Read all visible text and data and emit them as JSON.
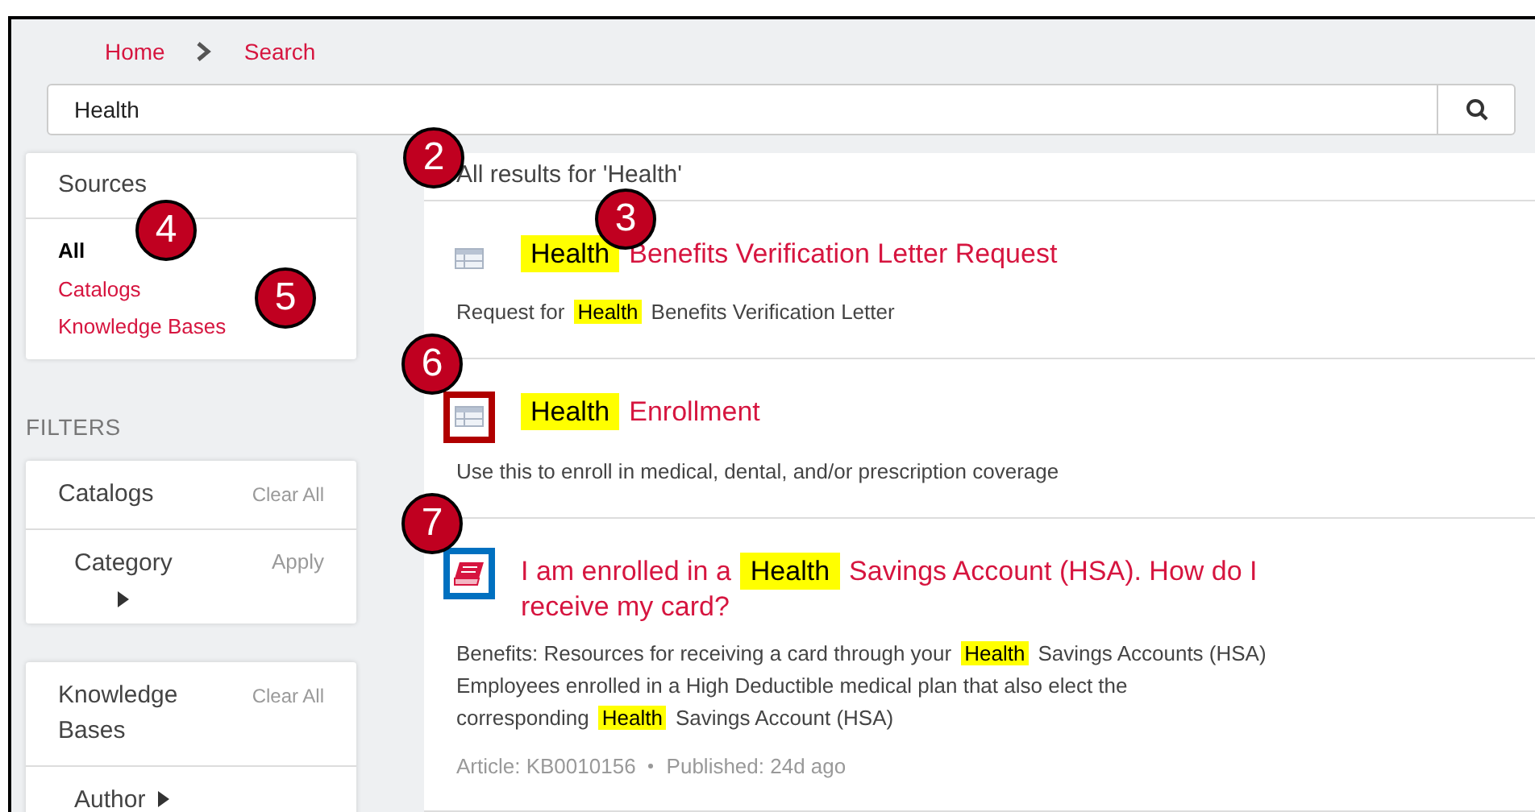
{
  "breadcrumb": [
    {
      "label": "Home"
    },
    {
      "label": "Search"
    }
  ],
  "search": {
    "value": "Health"
  },
  "sources": {
    "title": "Sources",
    "items": [
      {
        "label": "All",
        "selected": true,
        "callout": "4"
      },
      {
        "label": "Catalogs",
        "selected": false,
        "callout": "5"
      },
      {
        "label": "Knowledge Bases",
        "selected": false
      }
    ]
  },
  "filters": {
    "heading": "FILTERS",
    "groups": [
      {
        "title": "Catalogs",
        "clear": "Clear All",
        "facets": [
          {
            "label": "Category",
            "action": "Apply"
          }
        ]
      },
      {
        "title": "Knowledge Bases",
        "clear": "Clear All",
        "facets": [
          {
            "label": "Author"
          }
        ]
      }
    ]
  },
  "results": {
    "heading": "All results for 'Health'",
    "callout": "2",
    "items": [
      {
        "kind": "catalog",
        "title_callout": "3",
        "title": [
          [
            {
              "text": "Health",
              "highlight": true
            },
            {
              "text": "Benefits Verification Letter Request",
              "highlight": false
            }
          ]
        ],
        "description": [
          [
            {
              "text": "Request for",
              "highlight": false
            },
            {
              "text": "Health",
              "highlight": true
            },
            {
              "text": "Benefits Verification Letter",
              "highlight": false
            }
          ]
        ]
      },
      {
        "kind": "catalog",
        "icon_callout": "6",
        "icon_frame": {
          "color": "#b00000"
        },
        "title": [
          [
            {
              "text": "Health",
              "highlight": true
            },
            {
              "text": "Enrollment",
              "highlight": false
            }
          ]
        ],
        "description": [
          [
            {
              "text": "Use this to enroll in medical, dental, and/or prescription coverage",
              "highlight": false
            }
          ]
        ]
      },
      {
        "kind": "article",
        "icon_callout": "7",
        "icon_frame": {
          "color": "#0070c0"
        },
        "title": [
          [
            {
              "text": "I am enrolled in a",
              "highlight": false
            },
            {
              "text": "Health",
              "highlight": true
            },
            {
              "text": "Savings Account (HSA). How do I",
              "highlight": false
            }
          ],
          [
            {
              "text": "receive my card?",
              "highlight": false
            }
          ]
        ],
        "description": [
          [
            {
              "text": "Benefits: Resources for receiving a card through your",
              "highlight": false
            },
            {
              "text": "Health",
              "highlight": true
            },
            {
              "text": "Savings Accounts (HSA)",
              "highlight": false
            }
          ],
          [
            {
              "text": "Employees enrolled in a High Deductible medical plan that also elect the",
              "highlight": false
            }
          ],
          [
            {
              "text": "corresponding",
              "highlight": false
            },
            {
              "text": "Health",
              "highlight": true
            },
            {
              "text": "Savings Account (HSA)",
              "highlight": false
            }
          ]
        ],
        "meta": [
          "Article: KB0010156",
          "Published: 24d ago"
        ]
      }
    ]
  }
}
